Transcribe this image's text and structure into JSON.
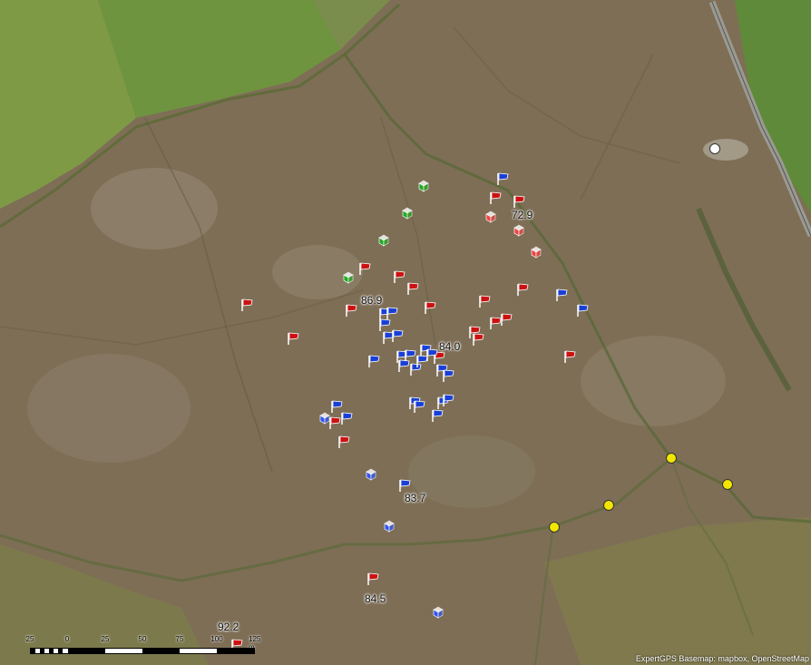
{
  "map": {
    "attribution": "ExpertGPS Basemap: mapbox, OpenStreetMap",
    "scale": {
      "labels": [
        "25",
        "0",
        "25",
        "50",
        "75",
        "100",
        "125 m"
      ]
    },
    "labels": [
      {
        "id": "lbl-729",
        "text": "72.9"
      },
      {
        "id": "lbl-869",
        "text": "86.9"
      },
      {
        "id": "lbl-840",
        "text": "84.0"
      },
      {
        "id": "lbl-837",
        "text": "83.7"
      },
      {
        "id": "lbl-845",
        "text": "84.5"
      },
      {
        "id": "lbl-922",
        "text": "92.2"
      }
    ],
    "marker_types": {
      "red-flag": {
        "color": "#cc1111",
        "icon": "red-flag-icon"
      },
      "blue-flag": {
        "color": "#1a3fd6",
        "icon": "blue-flag-icon"
      },
      "green-cube": {
        "color": "#22aa22",
        "icon": "green-cube-icon"
      },
      "red-cube": {
        "color": "#ee4444",
        "icon": "red-cube-icon"
      },
      "blue-cube": {
        "color": "#3355ee",
        "icon": "blue-cube-icon"
      },
      "yellow-dot": {
        "color": "#f2e600",
        "icon": "yellow-dot-icon"
      },
      "white-dot": {
        "color": "#ffffff",
        "icon": "white-dot-icon"
      }
    },
    "colors": {
      "field_green": "#7f9a45",
      "moorland": "#7d6d55"
    }
  }
}
